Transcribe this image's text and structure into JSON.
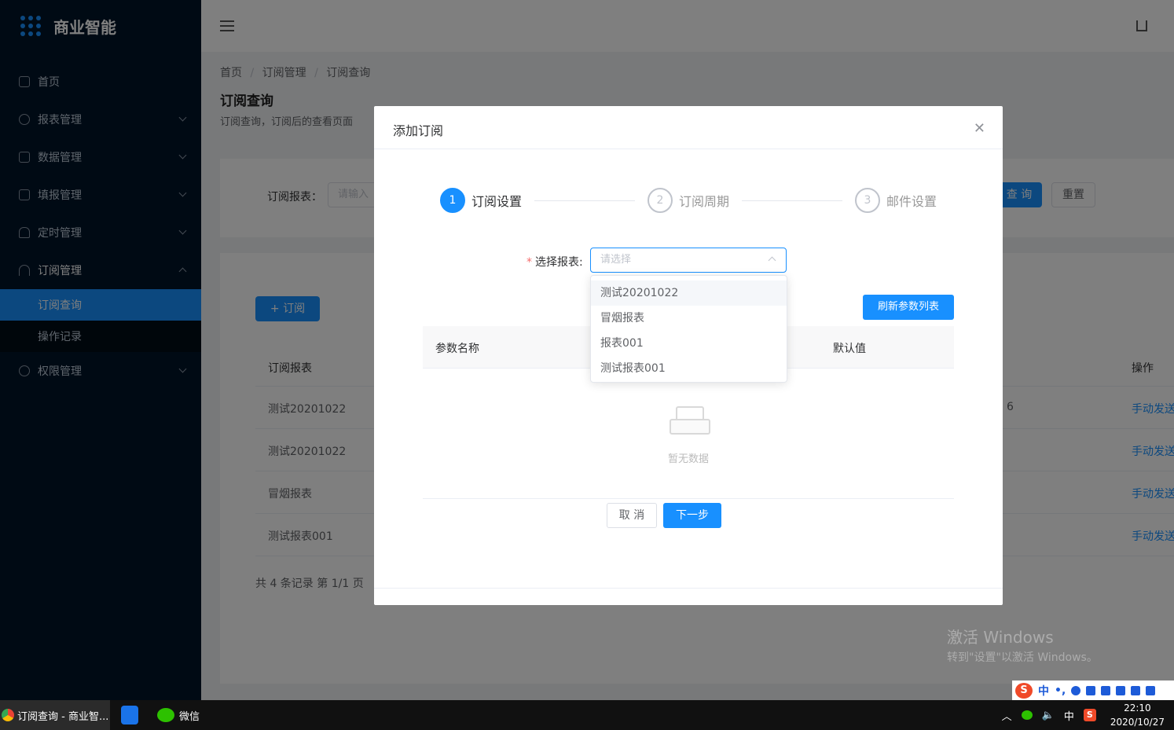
{
  "sidebar": {
    "title": "商业智能",
    "items": [
      {
        "label": "首页"
      },
      {
        "label": "报表管理"
      },
      {
        "label": "数据管理"
      },
      {
        "label": "填报管理"
      },
      {
        "label": "定时管理"
      },
      {
        "label": "订阅管理"
      },
      {
        "label": "权限管理"
      }
    ],
    "submenu": [
      {
        "label": "订阅查询"
      },
      {
        "label": "操作记录"
      }
    ]
  },
  "breadcrumb": [
    "首页",
    "/",
    "订阅管理",
    "/",
    "订阅查询"
  ],
  "page": {
    "title": "订阅查询",
    "desc": "订阅查询，订阅后的查看页面"
  },
  "filter": {
    "label": "订阅报表：",
    "placeholder": "请输入",
    "query_btn": "查 询",
    "reset_btn": "重置"
  },
  "table": {
    "add_btn": "+ 订阅",
    "headers": [
      "订阅报表",
      "操作"
    ],
    "rows": [
      {
        "name": "测试20201022",
        "extra": "6",
        "action": "手动发送"
      },
      {
        "name": "测试20201022",
        "extra": "",
        "action": "手动发送"
      },
      {
        "name": "冒烟报表",
        "extra": "",
        "action": "手动发送"
      },
      {
        "name": "测试报表001",
        "extra": "",
        "action": "手动发送"
      }
    ],
    "pager": "共 4 条记录 第 1/1 页"
  },
  "dialog": {
    "title": "添加订阅",
    "steps": [
      {
        "num": "1",
        "label": "订阅设置"
      },
      {
        "num": "2",
        "label": "订阅周期"
      },
      {
        "num": "3",
        "label": "邮件设置"
      }
    ],
    "select_label": "选择报表:",
    "select_placeholder": "请选择",
    "refresh_btn": "刷新参数列表",
    "param_headers": [
      "参数名称",
      "默认值"
    ],
    "empty_text": "暂无数据",
    "cancel_btn": "取 消",
    "next_btn": "下一步"
  },
  "dropdown": {
    "options": [
      "测试20201022",
      "冒烟报表",
      "报表001",
      "测试报表001"
    ]
  },
  "watermark": {
    "line1": "激活 Windows",
    "line2": "转到\"设置\"以激活 Windows。"
  },
  "ime": {
    "lang": "中",
    "punct": "•,"
  },
  "taskbar": {
    "app1": "订阅查询 - 商业智...",
    "app2": "微信",
    "ime_lang": "中",
    "time": "22:10",
    "date": "2020/10/27"
  },
  "colors": {
    "primary": "#1890ff",
    "sidebar_bg": "#001529",
    "required": "#f56c6c"
  }
}
